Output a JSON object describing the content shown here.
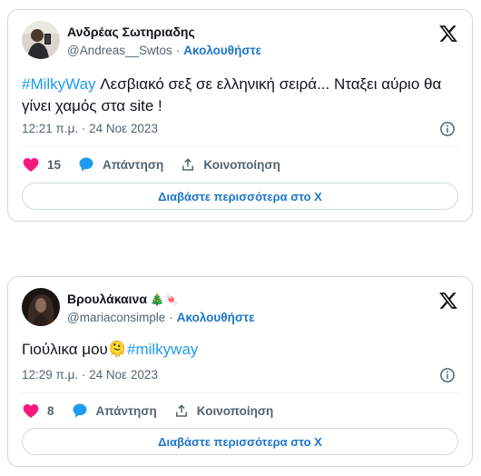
{
  "tweets": [
    {
      "name": "Ανδρέας Σωτηριαδης",
      "name_emoji": "",
      "handle": "@Andreas__Swtos",
      "follow_label": "Ακολουθήστε",
      "hashtag": "#MilkyWay",
      "text": " Λεσβιακό σεξ σε ελληνική σειρά... Νταξει αύριο θα γίνει χαμός στα site !",
      "timestamp": "12:21 π.μ. · 24 Νοε 2023",
      "likes": "15",
      "reply_label": "Απάντηση",
      "share_label": "Κοινοποίηση",
      "read_more_label": "Διαβάστε περισσότερα στο X"
    },
    {
      "name": "Βρουλάκαινα",
      "name_emoji": "🎄🍬",
      "handle": "@mariaconsimple",
      "follow_label": "Ακολουθήστε",
      "text_before": "Γιούλικα μου",
      "text_emoji": "🫠",
      "hashtag": "#milkyway",
      "timestamp": "12:29 π.μ. · 24 Νοε 2023",
      "likes": "8",
      "reply_label": "Απάντηση",
      "share_label": "Κοινοποίηση",
      "read_more_label": "Διαβάστε περισσότερα στο X"
    }
  ],
  "colors": {
    "accent": "#1d9bf0",
    "link": "#1d75c9",
    "heart": "#f91880",
    "secondary_text": "#536471",
    "border": "#cfd9de"
  },
  "icons": [
    "x-logo-icon",
    "info-icon",
    "heart-icon",
    "reply-bubble-icon",
    "share-icon"
  ]
}
